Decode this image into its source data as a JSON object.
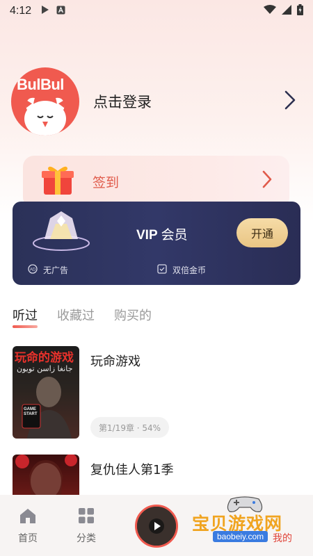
{
  "status_bar": {
    "time": "4:12"
  },
  "profile": {
    "avatar_text": "BulBul",
    "login_label": "点击登录"
  },
  "signin": {
    "label": "签到"
  },
  "vip": {
    "title_en": "VIP",
    "title_cn": "会员",
    "button_label": "开通",
    "features": [
      "无广告",
      "双倍金币"
    ]
  },
  "tabs": [
    "听过",
    "收藏过",
    "购买的"
  ],
  "active_tab": "听过",
  "books": [
    {
      "title": "玩命游戏",
      "cover_text": "玩命的游戏",
      "cover_subtitle": "جانغا زاسن تويون",
      "cover_badge": "GAME START",
      "progress": "第1/19章 · 54%"
    },
    {
      "title": "复仇佳人第1季"
    }
  ],
  "bottom_nav": [
    {
      "label": "首页",
      "icon": "home-icon"
    },
    {
      "label": "分类",
      "icon": "grid-icon"
    },
    {
      "label": "我的",
      "icon": "user-icon"
    }
  ],
  "watermark": {
    "text": "宝贝游戏网",
    "url": "baobeiy.com"
  },
  "colors": {
    "accent": "#f05a4f",
    "vip_bg": "#2f3563",
    "vip_button": "#f1d39a"
  }
}
